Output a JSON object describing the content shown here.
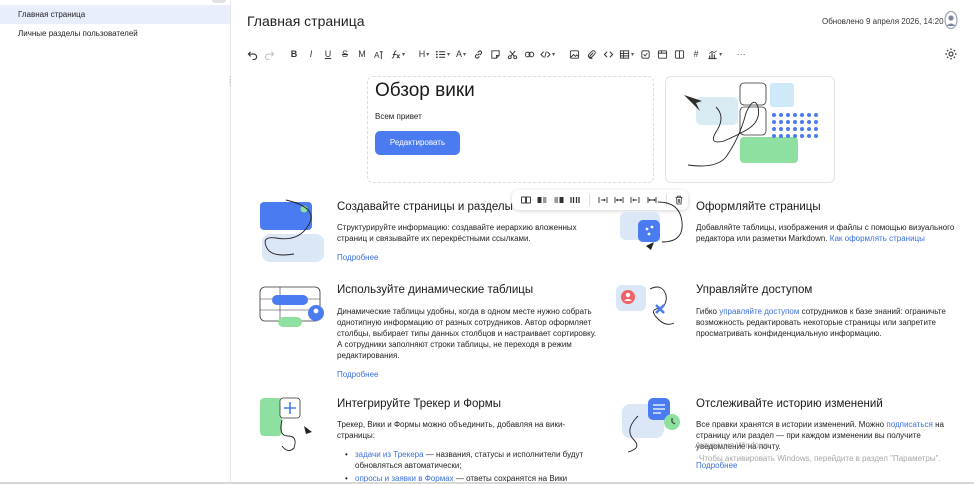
{
  "sidebar": {
    "items": [
      {
        "label": "Главная страница",
        "active": true
      },
      {
        "label": "Личные разделы пользователей",
        "active": false
      }
    ]
  },
  "header": {
    "title": "Главная страница",
    "updated": "Обновлено 9 апреля 2026, 14:20"
  },
  "toolbar": {
    "undo": "undo-icon",
    "redo": "redo-icon",
    "bold": "B",
    "italic": "I",
    "underline": "U",
    "strike": "S",
    "mark": "M",
    "heading": "H",
    "text_color": "A",
    "hash": "#",
    "more": "···"
  },
  "hero": {
    "title": "Обзор вики",
    "subtitle": "Всем привет",
    "button": "Редактировать"
  },
  "features": [
    {
      "title": "Создавайте страницы и разделы",
      "text_a": "Структурируйте информацию: создавайте иерархию вложенных страниц и связывайте их перекрёстными ссылками.",
      "more": "Подробнее"
    },
    {
      "title": "Оформляйте страницы",
      "text_a": "Добавляйте таблицы, изображения и файлы с помощью визуального редактора или разметки Markdown.",
      "link": "Как оформлять страницы"
    },
    {
      "title": "Используйте динамические таблицы",
      "text_a": "Динамические таблицы удобны, когда в одном месте нужно собрать однотипную информацию от разных сотрудников. Автор оформляет столбцы, выбирает типы данных столбцов и настраивает сортировку. А сотрудники заполняют строки таблицы, не переходя в режим редактирования.",
      "more": "Подробнее"
    },
    {
      "title": "Управляйте доступом",
      "text_a": "Гибко",
      "link": "управляйте доступом",
      "text_b": "сотрудников к базе знаний: ограничьте возможность редактировать некоторые страницы или запретите просматривать конфиденциальную информацию."
    },
    {
      "title": "Интегрируйте Трекер и Формы",
      "text_a": "Трекер, Вики и Формы можно объединить, добавляя на вики-страницы:",
      "list": [
        {
          "link": "задачи из Трекера",
          "text": "— названия, статусы и исполнители будут обновляться автоматически;"
        },
        {
          "link": "опросы и заявки в Формах",
          "text": "— ответы сохранятся на Вики"
        }
      ]
    },
    {
      "title": "Отслеживайте историю изменений",
      "text_a": "Все правки хранятся в истории изменений. Можно",
      "link": "подписаться",
      "text_b": "на страницу или раздел — при каждом изменении вы получите уведомление на почту.",
      "more": "Подробнее"
    }
  ],
  "watermark": {
    "line1": "Активация Windows",
    "line2": "Чтобы активировать Windows, перейдите в раздел \"Параметры\"."
  },
  "colors": {
    "accent": "#4b7bf0",
    "link": "#3b6fe0",
    "sidebar_active": "#e8eefc"
  }
}
